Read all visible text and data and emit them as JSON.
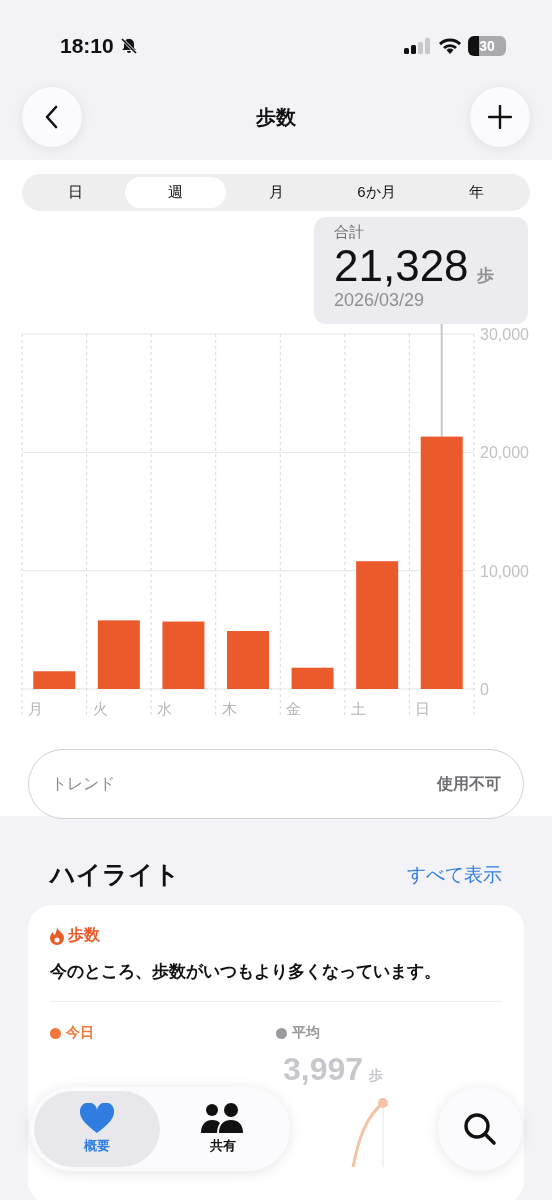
{
  "status_bar": {
    "time": "18:10",
    "battery": "30"
  },
  "nav": {
    "title": "歩数"
  },
  "segments": [
    {
      "label": "日",
      "selected": false
    },
    {
      "label": "週",
      "selected": true
    },
    {
      "label": "月",
      "selected": false
    },
    {
      "label": "6か月",
      "selected": false
    },
    {
      "label": "年",
      "selected": false
    }
  ],
  "tooltip": {
    "label": "合計",
    "value": "21,328",
    "unit": "歩",
    "date": "2026/03/29"
  },
  "chart": {
    "chart_data": {
      "type": "bar",
      "categories": [
        "月",
        "火",
        "水",
        "木",
        "金",
        "土",
        "日"
      ],
      "values": [
        1500,
        5800,
        5700,
        4900,
        1800,
        10800,
        21328
      ],
      "ylim": [
        0,
        30000
      ],
      "yticks": [
        {
          "value": 0,
          "label": "0"
        },
        {
          "value": 10000,
          "label": "10,000"
        },
        {
          "value": 20000,
          "label": "20,000"
        },
        {
          "value": 30000,
          "label": "30,000"
        }
      ],
      "color": "#eb5a2b"
    }
  },
  "trend": {
    "label": "トレンド",
    "value": "使用不可"
  },
  "highlights": {
    "title": "ハイライト",
    "see_all": "すべて表示",
    "card": {
      "category": "歩数",
      "message": "今のところ、歩数がいつもより多くなっています。",
      "legend": [
        {
          "label": "今日",
          "color": "#f0763a"
        },
        {
          "label": "平均",
          "color": "#9a9a9e"
        }
      ],
      "average_value": "3,997",
      "average_unit": "歩"
    }
  },
  "tab_bar": [
    {
      "label": "概要",
      "kind": "heart",
      "selected": true
    },
    {
      "label": "共有",
      "kind": "people",
      "selected": false
    }
  ]
}
